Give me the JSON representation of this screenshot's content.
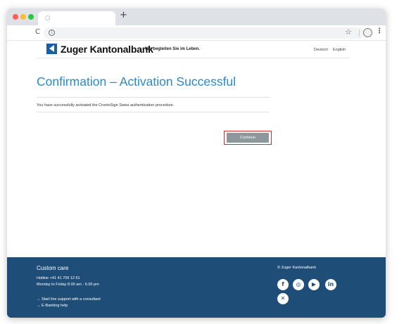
{
  "browser": {
    "new_tab_symbol": "+",
    "reload_symbol": "C",
    "info_symbol": "i",
    "star_symbol": "☆",
    "menu_symbol": "⋮"
  },
  "header": {
    "brand_name": "Zuger Kantonalbank",
    "slogan": "Wir begleiten Sie im Leben.",
    "languages": [
      "Deutsch",
      "English"
    ]
  },
  "main": {
    "title": "Confirmation – Activation Successful",
    "message": "You have successfully activated the CrontoSign Swiss authentication procedure.",
    "continue_label": "Continue"
  },
  "footer": {
    "title": "Custom care",
    "hotline": "Hotline +41 41 709 12 61",
    "hours": "Monday to Friday 8.00 am - 6.00 pm",
    "live_support": "→ Start live support with a consultant",
    "ebanking_help": "→ E-Banking help",
    "copyright": "© Zuger Kantonalbank",
    "social_icons": [
      "facebook-icon",
      "instagram-icon",
      "youtube-icon",
      "linkedin-icon",
      "xing-icon"
    ],
    "social_glyphs": [
      "f",
      "◎",
      "▶",
      "in",
      "✕"
    ]
  },
  "colors": {
    "brand_blue": "#1a5da0",
    "title_blue": "#2a8ac8",
    "footer_bg": "#1e4d78",
    "button_gray": "#8e979c",
    "highlight_red": "#d32f2f"
  }
}
